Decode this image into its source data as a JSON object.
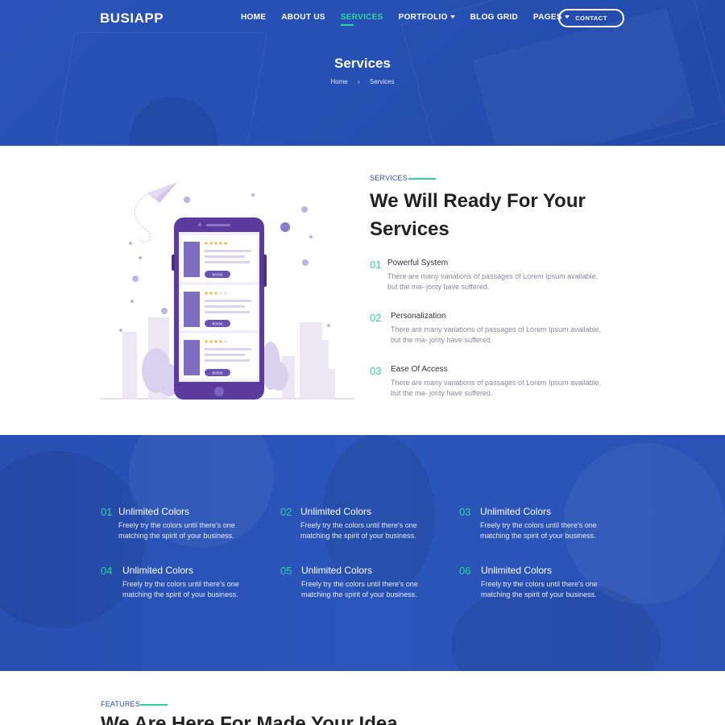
{
  "header": {
    "brand": "BUSIAPP",
    "nav": [
      {
        "label": "HOME",
        "active": false,
        "dropdown": false
      },
      {
        "label": "ABOUT US",
        "active": false,
        "dropdown": false
      },
      {
        "label": "SERVICES",
        "active": true,
        "dropdown": false
      },
      {
        "label": "PORTFOLIO",
        "active": false,
        "dropdown": true
      },
      {
        "label": "BLOG GRID",
        "active": false,
        "dropdown": false
      },
      {
        "label": "PAGES",
        "active": false,
        "dropdown": true
      }
    ],
    "contact_label": "CONTACT"
  },
  "hero": {
    "title": "Services",
    "breadcrumb": [
      "Home",
      "Services"
    ],
    "breadcrumb_separator": "›"
  },
  "services": {
    "eyebrow": "SERVICES",
    "heading": "We Will Ready For Your Services",
    "items": [
      {
        "num": "01",
        "title": "Powerful System",
        "text": "There are many variations of passages of Lorem Ipsum available, but the ma- jority have suffered."
      },
      {
        "num": "02",
        "title": "Personalization",
        "text": "There are many variations of passages of Lorem Ipsum available, but the ma- jority have suffered."
      },
      {
        "num": "03",
        "title": "Ease Of Access",
        "text": "There are many variations of passages of Lorem Ipsum available, but the ma- jority have suffered."
      }
    ],
    "illustration": {
      "book_labels": [
        "BOOK",
        "BOOK",
        "BOOK"
      ],
      "ratings": [
        5,
        3,
        4
      ]
    }
  },
  "features_band": {
    "items": [
      {
        "num": "01",
        "title": "Unlimited Colors",
        "text": "Freely try the colors until there's one matching the spirit of your business."
      },
      {
        "num": "02",
        "title": "Unlimited Colors",
        "text": "Freely try the colors until there's one matching the spirit of your business."
      },
      {
        "num": "03",
        "title": "Unlimited Colors",
        "text": "Freely try the colors until there's one matching the spirit of your business."
      },
      {
        "num": "04",
        "title": "Unlimited Colors",
        "text": "Freely try the colors until there's one matching the spirit of your business."
      },
      {
        "num": "05",
        "title": "Unlimited Colors",
        "text": "Freely try the colors until there's one matching the spirit of your business."
      },
      {
        "num": "06",
        "title": "Unlimited Colors",
        "text": "Freely try the colors until there's one matching the spirit of your business."
      }
    ]
  },
  "features": {
    "eyebrow": "FEATURES",
    "heading": "We Are Here For Made Your Idea"
  },
  "colors": {
    "primary_blue": "#2a52b8",
    "accent_green": "#2ed3a0",
    "illustration_purple": "#5b3c9e"
  }
}
